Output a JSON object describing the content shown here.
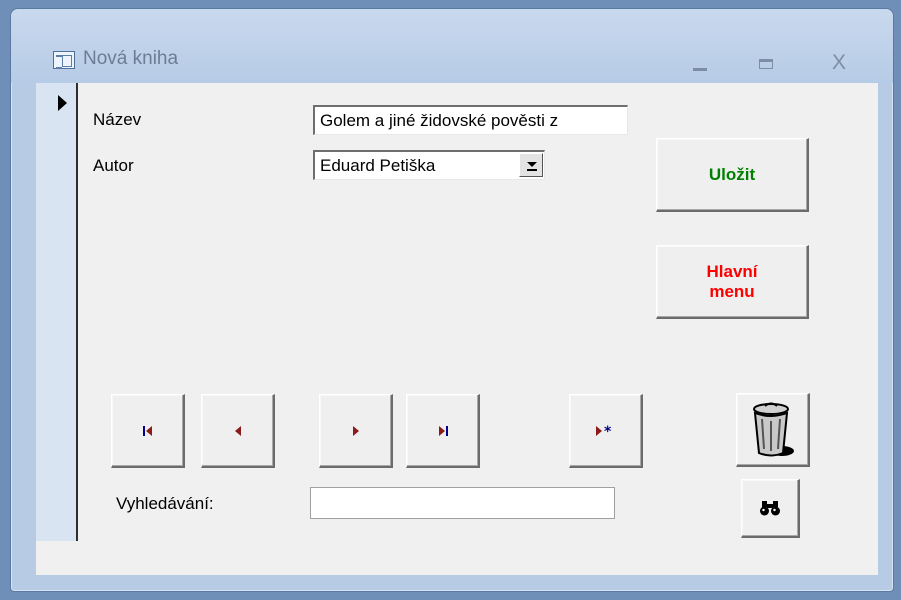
{
  "window": {
    "title": "Nová kniha"
  },
  "form": {
    "fields": {
      "nazev": {
        "label": "Název",
        "value": "Golem a jiné židovské pověsti z"
      },
      "autor": {
        "label": "Autor",
        "value": "Eduard Petiška"
      }
    },
    "buttons": {
      "save": {
        "label": "Uložit",
        "color": "#008000"
      },
      "main_menu": {
        "line1": "Hlavní",
        "line2": "menu",
        "color": "#ff0000"
      }
    },
    "navigation": {
      "first_icon": "first-record-icon",
      "previous_icon": "previous-record-icon",
      "next_icon": "next-record-icon",
      "last_icon": "last-record-icon",
      "new_icon": "new-record-icon",
      "glyphs": {
        "first": "⏮",
        "previous": "◀",
        "next": "▶",
        "last": "⏭",
        "new": "▶✱"
      },
      "colors": {
        "arrow": "#8b1a1a",
        "first_last_bar": "#00008b",
        "new_star": "#00008b"
      }
    },
    "search": {
      "label": "Vyhledávání:",
      "value": ""
    },
    "icons": {
      "delete": "trash-can-icon",
      "find": "binoculars-icon"
    }
  }
}
